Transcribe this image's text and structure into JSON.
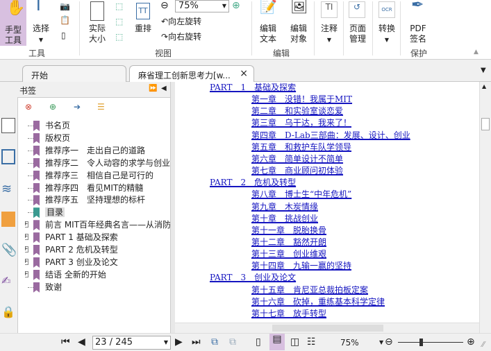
{
  "ribbon": {
    "hand_tool": "手型\n工具",
    "select": "选择",
    "actual_size": "实际\n大小",
    "reflow": "重排",
    "zoom_value": "75%",
    "rotate_left": "向左旋转",
    "rotate_right": "向右旋转",
    "edit_text": "编辑\n文本",
    "edit_object": "编辑\n对象",
    "annotate": "注释",
    "page_manage": "页面\n管理",
    "convert": "转换",
    "pdf_sign": "PDF\n签名",
    "groups": {
      "tools": "工具",
      "view": "视图",
      "edit": "编辑",
      "protect": "保护"
    }
  },
  "tabs": [
    {
      "label": "开始"
    },
    {
      "label": "麻省理工创新思考力[w...",
      "close": "×"
    }
  ],
  "bookmarks": {
    "title": "书签",
    "items": [
      {
        "label": "书名页",
        "expandable": false
      },
      {
        "label": "版权页",
        "expandable": false
      },
      {
        "label": "推荐序一　走出自己的道路",
        "expandable": false
      },
      {
        "label": "推荐序二　令人动容的求学与创业",
        "expandable": false
      },
      {
        "label": "推荐序三　相信自己是可行的",
        "expandable": false
      },
      {
        "label": "推荐序四　看见MIT的精髓",
        "expandable": false
      },
      {
        "label": "推荐序五　坚持理想的标杆",
        "expandable": false
      },
      {
        "label": "目录",
        "expandable": false,
        "selected": true
      },
      {
        "label": "前言 MIT百年经典名言——从消防",
        "expandable": true
      },
      {
        "label": "PART 1 基础及探索",
        "expandable": true
      },
      {
        "label": "PART 2 危机及转型",
        "expandable": true
      },
      {
        "label": "PART 3 创业及论文",
        "expandable": true
      },
      {
        "label": "结语 全新的开始",
        "expandable": true
      },
      {
        "label": "致谢",
        "expandable": false
      }
    ]
  },
  "toc": [
    {
      "text": "PART　1　基础及探索",
      "level": 0
    },
    {
      "text": "第一章　没错！我属于MIT",
      "level": 1
    },
    {
      "text": "第二章　和实验室谈恋爱",
      "level": 1
    },
    {
      "text": "第三章　乌干达，我来了！",
      "level": 1
    },
    {
      "text": "第四章　D-Lab三部曲：发展、设计、创业",
      "level": 1
    },
    {
      "text": "第五章　和救护车队学领导",
      "level": 1
    },
    {
      "text": "第六章　简单设计不简单",
      "level": 1
    },
    {
      "text": "第七章　商业顾问初体验",
      "level": 1
    },
    {
      "text": "PART　2　危机及转型",
      "level": 0
    },
    {
      "text": "第八章　博士生“中年危机”",
      "level": 1
    },
    {
      "text": "第九章　木炭情缘",
      "level": 1
    },
    {
      "text": "第十章　挑战创业",
      "level": 1
    },
    {
      "text": "第十一章　脱胎换骨",
      "level": 1
    },
    {
      "text": "第十二章　豁然开朗",
      "level": 1
    },
    {
      "text": "第十三章　创业维艰",
      "level": 1
    },
    {
      "text": "第十四章　九输一赢的坚持",
      "level": 1
    },
    {
      "text": "PART　3　创业及论文",
      "level": 0
    },
    {
      "text": "第十五章　肯尼亚总裁拍板定案",
      "level": 1
    },
    {
      "text": "第十六章　砍掉，重练基本科学定律",
      "level": 1
    },
    {
      "text": "第十七章　放手转型",
      "level": 1
    }
  ],
  "status": {
    "page": "23 / 245",
    "zoom": "75%",
    "zoom_fraction": 0.35
  },
  "colors": {
    "link": "#1515c0",
    "accent": "#d8c0e0",
    "bookmark": "#9a6aa0"
  }
}
